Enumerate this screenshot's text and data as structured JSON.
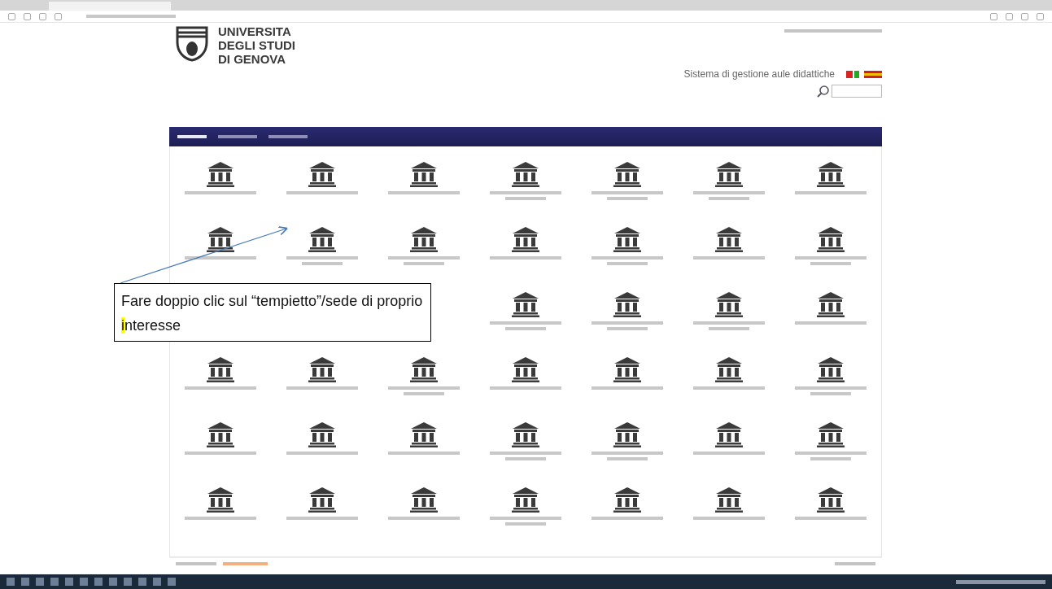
{
  "header": {
    "university_name": [
      "UNIVERSITA",
      "DEGLI STUDI",
      "DI GENOVA"
    ],
    "system_title": "Sistema di gestione aule didattiche"
  },
  "nav": {
    "items": [
      {
        "selected": true
      },
      {
        "selected": false
      },
      {
        "selected": false
      }
    ]
  },
  "grid": {
    "rows": [
      [
        {
          "kind": "one-line"
        },
        {
          "kind": "one-line"
        },
        {
          "kind": "one-line"
        },
        {
          "kind": "two-line"
        },
        {
          "kind": "two-line"
        },
        {
          "kind": "two-line"
        },
        {
          "kind": "one-line"
        }
      ],
      [
        {
          "kind": "one-line"
        },
        {
          "kind": "two-line"
        },
        {
          "kind": "two-line"
        },
        {
          "kind": "one-line"
        },
        {
          "kind": "two-line"
        },
        {
          "kind": "one-line"
        },
        {
          "kind": "two-line"
        }
      ],
      [
        {
          "kind": "covered"
        },
        {
          "kind": "covered"
        },
        {
          "kind": "covered"
        },
        {
          "kind": "two-line"
        },
        {
          "kind": "two-line"
        },
        {
          "kind": "two-line"
        },
        {
          "kind": "one-line"
        }
      ],
      [
        {
          "kind": "one-line"
        },
        {
          "kind": "one-line"
        },
        {
          "kind": "two-line"
        },
        {
          "kind": "one-line"
        },
        {
          "kind": "one-line"
        },
        {
          "kind": "one-line"
        },
        {
          "kind": "two-line"
        }
      ],
      [
        {
          "kind": "one-line"
        },
        {
          "kind": "one-line"
        },
        {
          "kind": "one-line"
        },
        {
          "kind": "two-line"
        },
        {
          "kind": "two-line"
        },
        {
          "kind": "one-line"
        },
        {
          "kind": "two-line"
        }
      ],
      [
        {
          "kind": "one-line"
        },
        {
          "kind": "one-line"
        },
        {
          "kind": "one-line"
        },
        {
          "kind": "two-line"
        },
        {
          "kind": "one-line"
        },
        {
          "kind": "one-line"
        },
        {
          "kind": "one-line"
        }
      ]
    ]
  },
  "callout": {
    "text": "Fare doppio clic sul “tempietto”/sede di proprio **i**nteresse"
  }
}
